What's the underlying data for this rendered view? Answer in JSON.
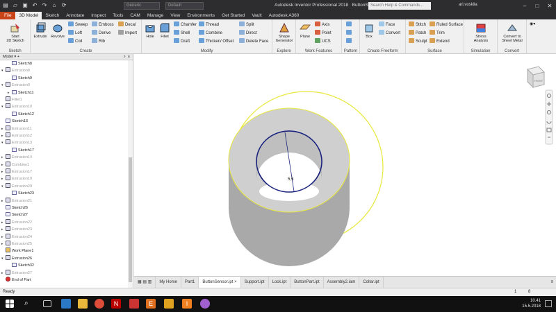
{
  "titlebar": {
    "qat_icons": [
      "file-icon",
      "open-icon",
      "save-icon",
      "undo-icon",
      "redo-icon",
      "home-icon",
      "update-icon"
    ],
    "material_value": "Generic",
    "appearance_value": "Default",
    "app_title": "Autodesk Inventor Professional 2018",
    "doc_title": "ButtonSensor",
    "search_placeholder": "Search Help & Commands...",
    "user": "ari.voskila"
  },
  "tabs": [
    "File",
    "3D Model",
    "Sketch",
    "Annotate",
    "Inspect",
    "Tools",
    "CAM",
    "Manage",
    "View",
    "Environments",
    "Get Started",
    "Vault",
    "Autodesk A360"
  ],
  "active_tab": "3D Model",
  "ribbon": {
    "sketch": {
      "start_line1": "Start",
      "start_line2": "2D Sketch",
      "label": "Sketch"
    },
    "create": {
      "extrude": "Extrude",
      "revolve": "Revolve",
      "sweep": "Sweep",
      "loft": "Loft",
      "coil": "Coil",
      "emboss": "Emboss",
      "derive": "Derive",
      "rib": "Rib",
      "decal": "Decal",
      "import": "Import",
      "label": "Create"
    },
    "modify": {
      "hole": "Hole",
      "fillet": "Fillet",
      "chamfer": "Chamfer",
      "shell": "Shell",
      "draft": "Draft",
      "thread": "Thread",
      "combine": "Combine",
      "thicken": "Thicken/ Offset",
      "split": "Split",
      "direct": "Direct",
      "delete_face": "Delete Face",
      "label": "Modify"
    },
    "explore": {
      "line1": "Shape",
      "line2": "Generator",
      "label": "Explore"
    },
    "workfeatures": {
      "plane": "Plane",
      "axis": "Axis",
      "point": "Point",
      "ucs": "UCS",
      "label": "Work Features"
    },
    "pattern": {
      "label": "Pattern"
    },
    "freeform": {
      "box": "Box",
      "face": "Face",
      "convert": "Convert",
      "label": "Create Freeform"
    },
    "surface": {
      "stitch": "Stitch",
      "patch": "Patch",
      "sculpt": "Sculpt",
      "ruled": "Ruled Surface",
      "trim": "Trim",
      "extend": "Extend",
      "label": "Surface"
    },
    "simulation": {
      "line1": "Stress",
      "line2": "Analysis",
      "label": "Simulation"
    },
    "convert": {
      "line1": "Convert to",
      "line2": "Sheet Metal",
      "label": "Convert"
    }
  },
  "browser": {
    "tab_label": "Model",
    "nodes": [
      {
        "label": "Sketch8",
        "kind": "sketch",
        "indent": 2,
        "expander": "",
        "dim": false
      },
      {
        "label": "Extrusion8",
        "kind": "feature",
        "indent": 1,
        "expander": "v",
        "dim": true
      },
      {
        "label": "Sketch9",
        "kind": "sketch",
        "indent": 2,
        "expander": "",
        "dim": false
      },
      {
        "label": "Extrusion9",
        "kind": "feature",
        "indent": 1,
        "expander": "v",
        "dim": true
      },
      {
        "label": "Sketch11",
        "kind": "sketch",
        "indent": 2,
        "expander": ">",
        "dim": false
      },
      {
        "label": "Fillet1",
        "kind": "feature",
        "indent": 1,
        "expander": "",
        "dim": true
      },
      {
        "label": "Extrusion10",
        "kind": "feature",
        "indent": 1,
        "expander": "v",
        "dim": true
      },
      {
        "label": "Sketch12",
        "kind": "sketch",
        "indent": 2,
        "expander": "",
        "dim": false
      },
      {
        "label": "Sketch13",
        "kind": "sketch",
        "indent": 1,
        "expander": "",
        "dim": false
      },
      {
        "label": "Extrusion11",
        "kind": "feature",
        "indent": 1,
        "expander": ">",
        "dim": true
      },
      {
        "label": "Extrusion12",
        "kind": "feature",
        "indent": 1,
        "expander": ">",
        "dim": true
      },
      {
        "label": "Extrusion13",
        "kind": "feature",
        "indent": 1,
        "expander": "v",
        "dim": true
      },
      {
        "label": "Sketch17",
        "kind": "sketch",
        "indent": 2,
        "expander": "",
        "dim": false
      },
      {
        "label": "Extrusion14",
        "kind": "feature",
        "indent": 1,
        "expander": ">",
        "dim": true
      },
      {
        "label": "Combine1",
        "kind": "feature",
        "indent": 1,
        "expander": ">",
        "dim": true
      },
      {
        "label": "Extrusion17",
        "kind": "feature",
        "indent": 1,
        "expander": ">",
        "dim": true
      },
      {
        "label": "Extrusion19",
        "kind": "feature",
        "indent": 1,
        "expander": ">",
        "dim": true
      },
      {
        "label": "Extrusion20",
        "kind": "feature",
        "indent": 1,
        "expander": "v",
        "dim": true
      },
      {
        "label": "Sketch23",
        "kind": "sketch",
        "indent": 2,
        "expander": "",
        "dim": false
      },
      {
        "label": "Extrusion21",
        "kind": "feature",
        "indent": 1,
        "expander": ">",
        "dim": true
      },
      {
        "label": "Sketch26",
        "kind": "sketch",
        "indent": 1,
        "expander": "",
        "dim": false
      },
      {
        "label": "Sketch27",
        "kind": "sketch",
        "indent": 1,
        "expander": "",
        "dim": false
      },
      {
        "label": "Extrusion22",
        "kind": "feature",
        "indent": 1,
        "expander": ">",
        "dim": true
      },
      {
        "label": "Extrusion23",
        "kind": "feature",
        "indent": 1,
        "expander": ">",
        "dim": true
      },
      {
        "label": "Extrusion24",
        "kind": "feature",
        "indent": 1,
        "expander": ">",
        "dim": true
      },
      {
        "label": "Extrusion25",
        "kind": "feature",
        "indent": 1,
        "expander": ">",
        "dim": true
      },
      {
        "label": "Work Plane1",
        "kind": "plane",
        "indent": 1,
        "expander": "",
        "dim": false
      },
      {
        "label": "Extrusion26",
        "kind": "feature",
        "indent": 1,
        "expander": "v",
        "dim": false
      },
      {
        "label": "Sketch32",
        "kind": "sketch",
        "indent": 2,
        "expander": "",
        "dim": false
      },
      {
        "label": "Extrusion27",
        "kind": "feature",
        "indent": 1,
        "expander": ">",
        "dim": true
      },
      {
        "label": "End of Part",
        "kind": "end",
        "indent": 1,
        "expander": "",
        "dim": false
      }
    ]
  },
  "viewport": {
    "dimension_value": "5,5",
    "viewcube_label": "FRONT"
  },
  "doctabs": [
    "My Home",
    "Part1",
    "ButtonSensor.ipt",
    "Support.ipt",
    "Lock.ipt",
    "ButtonPart.ipt",
    "Assembly2.iam",
    "Collar.ipt"
  ],
  "active_doctab": "ButtonSensor.ipt",
  "status": {
    "text": "Ready",
    "count1": "1",
    "count2": "8"
  },
  "taskbar": {
    "time": "10.41",
    "date": "15.5.2018"
  },
  "colors": {
    "file_tab": "#c8451a",
    "highlight": "#e8e83a",
    "selected_edge": "#1a237e",
    "part_face": "#cfcfcf"
  }
}
